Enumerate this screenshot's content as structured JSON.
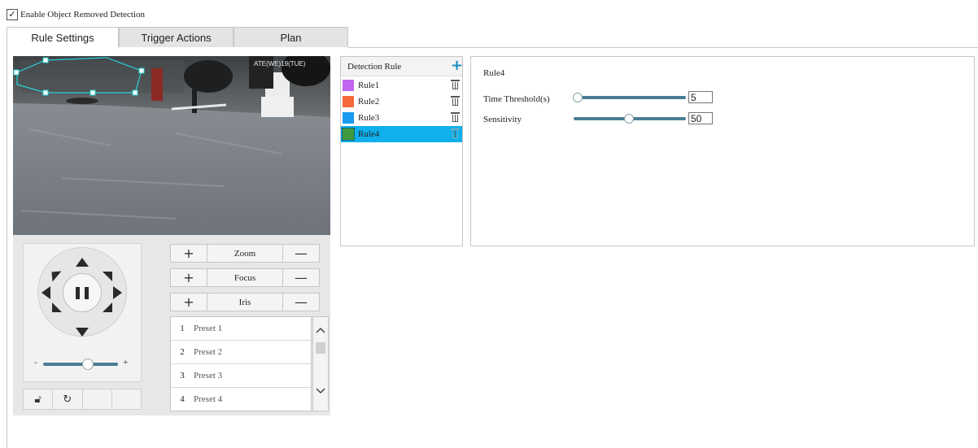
{
  "enable": {
    "label": "Enable Object Removed Detection",
    "checked": true
  },
  "tabs": [
    {
      "label": "Rule Settings",
      "active": true
    },
    {
      "label": "Trigger Actions",
      "active": false
    },
    {
      "label": "Plan",
      "active": false
    }
  ],
  "video": {
    "osd_text": "ATE(WE)19(TUE)"
  },
  "ptz": {
    "controls": [
      {
        "label": "Zoom",
        "plus": "+",
        "minus": "—"
      },
      {
        "label": "Focus",
        "plus": "+",
        "minus": "—"
      },
      {
        "label": "Iris",
        "plus": "+",
        "minus": "—"
      }
    ],
    "speed": {
      "minus": "-",
      "plus": "+",
      "level_fraction": 0.6
    },
    "presets": [
      {
        "num": "1",
        "name": "Preset 1"
      },
      {
        "num": "2",
        "name": "Preset 2"
      },
      {
        "num": "3",
        "name": "Preset 3"
      },
      {
        "num": "4",
        "name": "Preset 4"
      }
    ],
    "scroll_up": "^",
    "scroll_down": "v"
  },
  "rules": {
    "header": "Detection Rule",
    "add_icon": "+",
    "items": [
      {
        "label": "Rule1",
        "color": "#c066f0",
        "selected": false
      },
      {
        "label": "Rule2",
        "color": "#f5693a",
        "selected": false
      },
      {
        "label": "Rule3",
        "color": "#1a9af0",
        "selected": false
      },
      {
        "label": "Rule4",
        "color": "#3d9a3d",
        "selected": true
      }
    ]
  },
  "detail": {
    "title": "Rule4",
    "time_threshold": {
      "label": "Time Threshold(s)",
      "value": "5",
      "fraction": 0.0
    },
    "sensitivity": {
      "label": "Sensitivity",
      "value": "50",
      "fraction": 0.5
    }
  },
  "colors": {
    "accent": "#0fb0ec",
    "slider": "#4a7e93",
    "add": "#1b8fc0"
  }
}
